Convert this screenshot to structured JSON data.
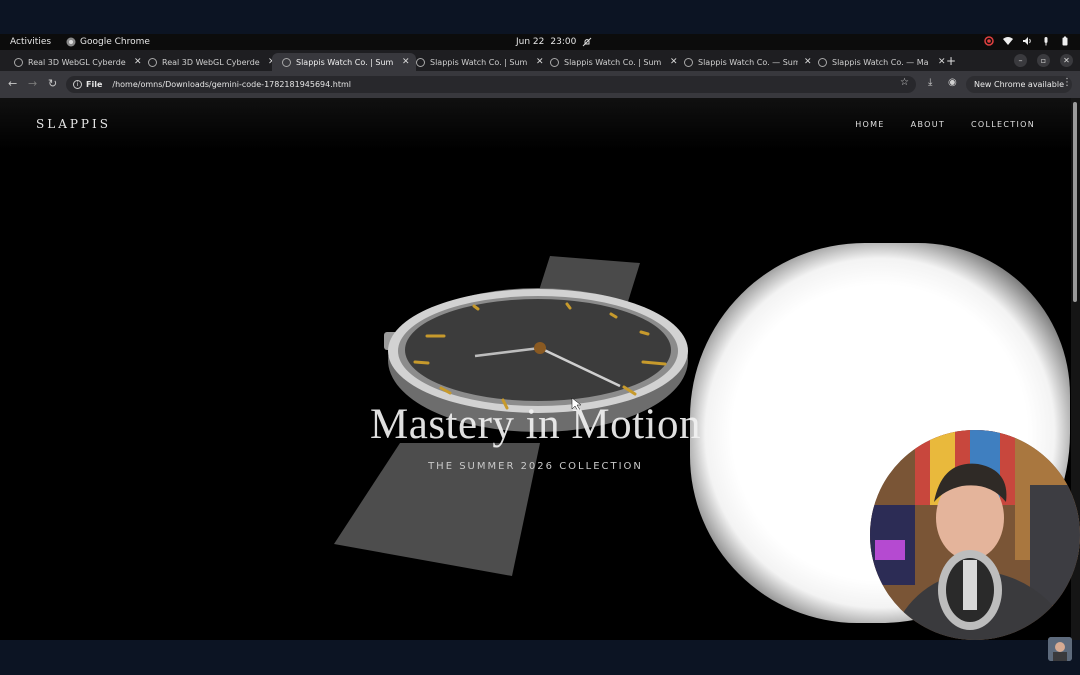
{
  "system_bar": {
    "activities": "Activities",
    "app_name": "Google Chrome",
    "date": "Jun 22",
    "time": "23:00"
  },
  "browser": {
    "tabs": [
      {
        "title": "Real 3D WebGL Cyberde",
        "active": false
      },
      {
        "title": "Real 3D WebGL Cyberde",
        "active": false
      },
      {
        "title": "Slappis Watch Co. | Sum",
        "active": true
      },
      {
        "title": "Slappis Watch Co. | Sum",
        "active": false
      },
      {
        "title": "Slappis Watch Co. | Sum",
        "active": false
      },
      {
        "title": "Slappis Watch Co. — Sum",
        "active": false
      },
      {
        "title": "Slappis Watch Co. — Ma",
        "active": false
      }
    ],
    "scheme": "File",
    "url": "/home/omns/Downloads/gemini-code-1782181945694.html",
    "update_label": "New Chrome available"
  },
  "site": {
    "logo": "SLAPPIS",
    "nav": [
      "HOME",
      "ABOUT",
      "COLLECTION"
    ],
    "hero_title": "Mastery in Motion",
    "hero_subtitle": "THE SUMMER 2026 COLLECTION"
  },
  "colors": {
    "page_bg": "#000000",
    "desktop_bg": "#0c1423",
    "watch_bezel": "#c9c9c9",
    "watch_dial": "#3c3c3c",
    "index_gold": "#c79a2c",
    "strap": "#4a4a4a"
  }
}
